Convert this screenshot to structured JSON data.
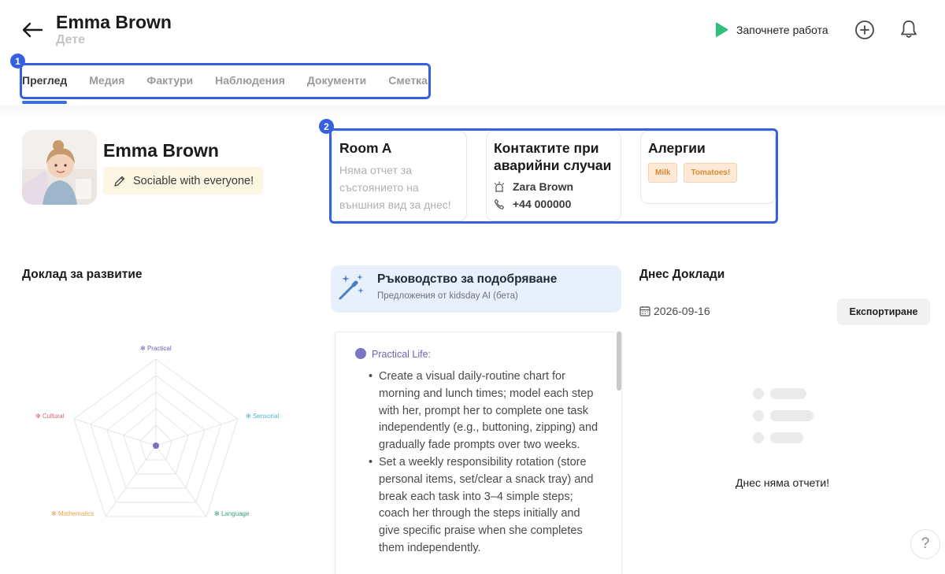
{
  "header": {
    "title": "Emma Brown",
    "subtitle": "Дете",
    "start_work_label": "Започнете работа"
  },
  "tabs": [
    {
      "label": "Преглед",
      "active": true
    },
    {
      "label": "Медия"
    },
    {
      "label": "Фактури"
    },
    {
      "label": "Наблюдения"
    },
    {
      "label": "Документи"
    },
    {
      "label": "Сметка"
    }
  ],
  "annotations": [
    "1",
    "2"
  ],
  "profile": {
    "name": "Emma Brown",
    "note": "Sociable with everyone!"
  },
  "room_card": {
    "title": "Room A",
    "status_line1": "Няма отчет за",
    "status_line2": "състоянието на",
    "status_line3": "външния вид за днес!"
  },
  "emergency_card": {
    "title_line1": "Контактите при",
    "title_line2": "аварийни случаи",
    "contact_name": "Zara Brown",
    "contact_phone": "+44 000000"
  },
  "allergies_card": {
    "title": "Алергии",
    "items": [
      "Milk",
      "Tomatoes!"
    ]
  },
  "development": {
    "title": "Доклад за развитие",
    "axes": [
      "Practical",
      "Sensorial",
      "Language",
      "Mathematics",
      "Cultural"
    ],
    "axis_colors": [
      "#6b64ba",
      "#4fb6c6",
      "#3aa37c",
      "#e8a24a",
      "#d9667a"
    ]
  },
  "guidance": {
    "title": "Ръководство за подобряване",
    "subtitle": "Предложения от kidsday AI (бета)",
    "category": "Practical Life:",
    "bullets": [
      "Create a visual daily-routine chart for morning and lunch times; model each step with her, prompt her to complete one task independently (e.g., buttoning, zipping) and gradually fade prompts over two weeks.",
      "Set a weekly responsibility rotation (store personal items, set/clear a snack tray) and break each task into 3–4 simple steps; coach her through the steps initially and give specific praise when she completes them independently."
    ]
  },
  "reports": {
    "title": "Днес Доклади",
    "date": "2026-09-16",
    "export_label": "Експортиране",
    "empty_text": "Днес няма отчети!"
  },
  "help_label": "?"
}
